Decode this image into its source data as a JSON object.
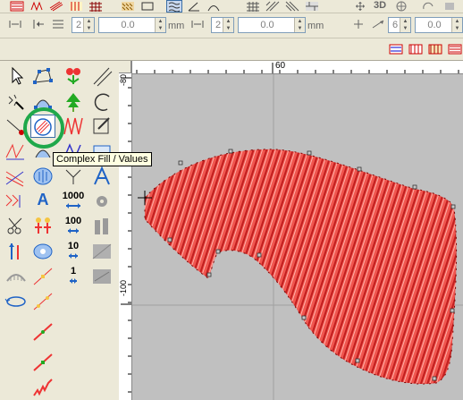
{
  "toolbar_top": {
    "label_3d": "3D",
    "density_a": "2",
    "density_a_mm": "0.0",
    "unit_a": "mm",
    "density_b": "2",
    "density_b_mm": "0.0",
    "unit_b": "mm",
    "count": "6",
    "count_mm": "0.0"
  },
  "canvas": {
    "ruler_h_tick": "60",
    "ruler_v_tick_top": "-80",
    "ruler_v_tick_bottom": "-100"
  },
  "toolbox": {
    "tool_1000": "1000",
    "tool_100": "100",
    "tool_10": "10",
    "tool_1": "1",
    "tool_text": "A"
  },
  "tooltip": {
    "text": "Complex Fill / Values"
  },
  "colors": {
    "stitch_red": "#e8302e",
    "highlight_circle": "#1fa84a",
    "canvas_bg": "#c0c0c0"
  }
}
